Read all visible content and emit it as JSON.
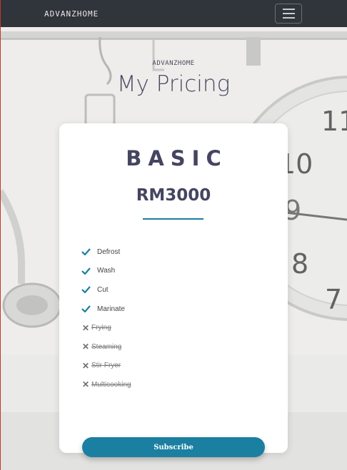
{
  "navbar": {
    "brand": "ADVANZHOME",
    "toggle_icon": "hamburger-menu-icon"
  },
  "hero": {
    "subtitle": "ADVANZHOME",
    "title": "My Pricing"
  },
  "plan": {
    "name": "BASIC",
    "price": "RM3000",
    "features": [
      {
        "label": "Defrost",
        "included": true
      },
      {
        "label": "Wash",
        "included": true
      },
      {
        "label": "Cut",
        "included": true
      },
      {
        "label": "Marinate",
        "included": true
      },
      {
        "label": "Frying",
        "included": false
      },
      {
        "label": "Steaming",
        "included": false
      },
      {
        "label": "Stir Fryer",
        "included": false
      },
      {
        "label": "Multicooking",
        "included": false
      }
    ],
    "cta": "Subscribe"
  },
  "colors": {
    "navbar": "#30343b",
    "accent": "#1a7fa0",
    "heading": "#454561"
  }
}
